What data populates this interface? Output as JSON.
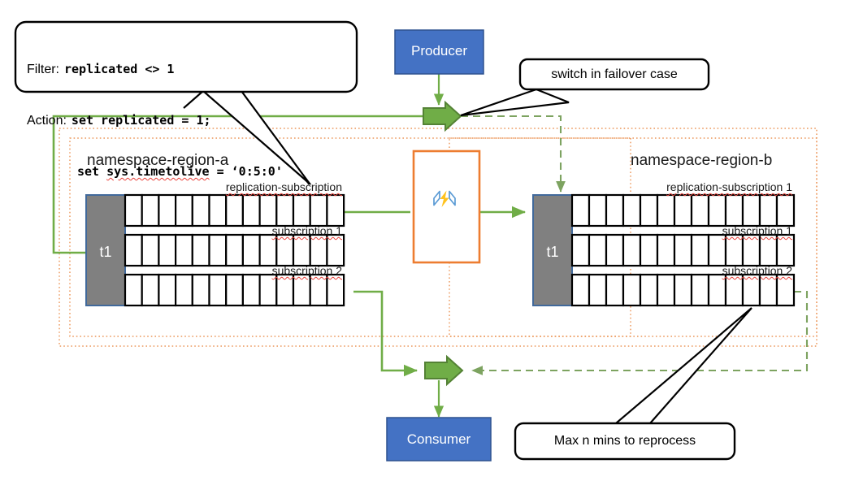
{
  "colors": {
    "producer_fill": "#4472C4",
    "producer_border": "#2F528F",
    "topic_fill": "#808080",
    "topic_border": "#41699B",
    "arrow_green": "#70AD47",
    "arrow_green_dark": "#548235",
    "line_green": "#70AD47",
    "dotted_orange": "#E8823A",
    "function_border": "#ED7D31",
    "callout_border": "#000000",
    "cell_border": "#000000",
    "squiggle_red": "#E8413A",
    "bolt_yellow": "#FFC21E",
    "bracket_blue": "#5B9BD5"
  },
  "callouts": {
    "filter_rule": {
      "name": "filter-action-callout",
      "line1_label": "Filter:",
      "line1_code": "replicated <> 1",
      "line2_label": "Action:",
      "line2_code": "set replicated = 1;",
      "line3_code_a": "set ",
      "line3_code_b": "sys.timetolive",
      "line3_code_c": " = ‘0:5:0'"
    },
    "failover": {
      "name": "switch-failover-callout",
      "text": "switch in failover case"
    },
    "reprocess": {
      "name": "max-mins-callout",
      "text": "Max n mins to reprocess"
    }
  },
  "nodes": {
    "producer": {
      "label": "Producer"
    },
    "consumer": {
      "label": "Consumer"
    },
    "function": {
      "icon": "azure-function-icon",
      "label": ""
    }
  },
  "regions": [
    {
      "id": "region-a",
      "title": "namespace-region-a",
      "topic": "t1",
      "subscriptions": [
        {
          "label": "replication-subscription",
          "cells": 13
        },
        {
          "label": "subscription 1",
          "cells": 13
        },
        {
          "label": "subscription 2",
          "cells": 13
        }
      ]
    },
    {
      "id": "region-b",
      "title": "namespace-region-b",
      "topic": "t1",
      "subscriptions": [
        {
          "label": "replication-subscription 1",
          "cells": 13
        },
        {
          "label": "subscription 1",
          "cells": 13
        },
        {
          "label": "subscription 2",
          "cells": 13
        }
      ]
    }
  ]
}
